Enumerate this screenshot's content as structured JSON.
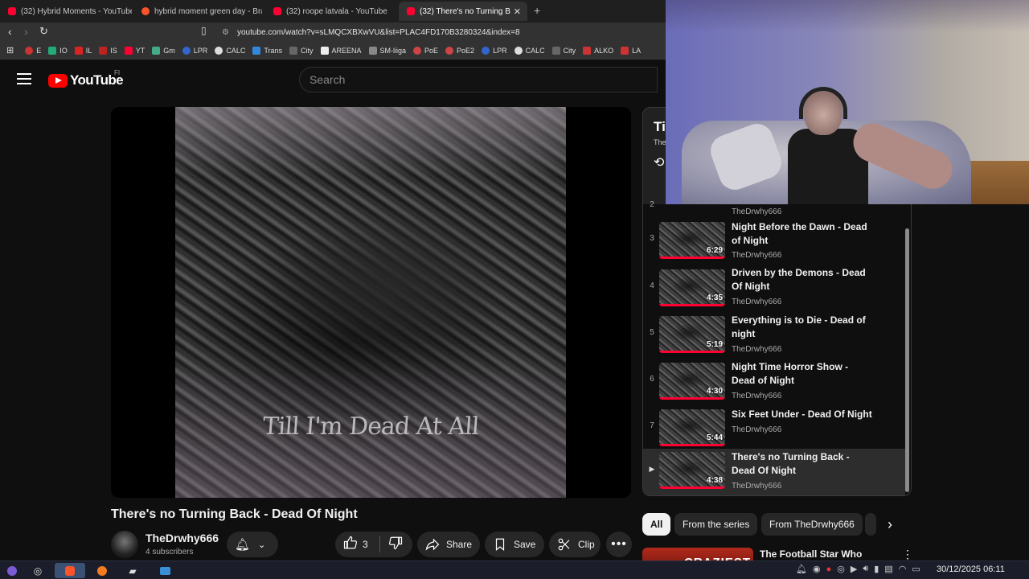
{
  "browser": {
    "tabs": [
      {
        "label": "(32) Hybrid Moments - YouTube",
        "favicon": "youtube-icon"
      },
      {
        "label": "hybrid moment green day - Bra",
        "favicon": "brave-icon"
      },
      {
        "label": "(32) roope latvala - YouTube",
        "favicon": "youtube-icon"
      },
      {
        "label": "(32) There's no Turning B",
        "favicon": "youtube-icon",
        "active": true
      }
    ],
    "url": "youtube.com/watch?v=sLMQCXBXwVU&list=PLAC4FD170B3280324&index=8",
    "bookmarks": [
      "E",
      "IO",
      "IL",
      "IS",
      "YT",
      "Gm",
      "LPR",
      "CALC",
      "Trans",
      "City",
      "AREENA",
      "SM-liiga",
      "PoE",
      "PoE2",
      "LPR",
      "CALC",
      "City",
      "ALKO",
      "LA"
    ]
  },
  "masthead": {
    "logo_text": "YouTube",
    "country_code": "FI",
    "search_placeholder": "Search"
  },
  "video": {
    "title": "There's no Turning Back - Dead Of Night",
    "thumbnail_text": "Till I'm Dead At All",
    "channel_name": "TheDrwhy666",
    "subscribers": "4 subscribers",
    "likes": "3",
    "share_label": "Share",
    "save_label": "Save",
    "clip_label": "Clip"
  },
  "playlist": {
    "title": "Ti",
    "subtitle": "The",
    "items": [
      {
        "index": "2",
        "title": "",
        "channel": "TheDrwhy666",
        "duration": ""
      },
      {
        "index": "3",
        "title": "Night Before the Dawn - Dead of Night",
        "channel": "TheDrwhy666",
        "duration": "6:29"
      },
      {
        "index": "4",
        "title": "Driven by the Demons - Dead Of Night",
        "channel": "TheDrwhy666",
        "duration": "4:35"
      },
      {
        "index": "5",
        "title": "Everything is to Die - Dead of night",
        "channel": "TheDrwhy666",
        "duration": "5:19"
      },
      {
        "index": "6",
        "title": "Night Time Horror Show - Dead of Night",
        "channel": "TheDrwhy666",
        "duration": "4:30"
      },
      {
        "index": "7",
        "title": "Six Feet Under - Dead Of Night",
        "channel": "TheDrwhy666",
        "duration": "5:44"
      },
      {
        "index": "▶",
        "title": "There's no Turning Back - Dead Of Night",
        "channel": "TheDrwhy666",
        "duration": "4:38",
        "current": true
      }
    ]
  },
  "chips": [
    "All",
    "From the series",
    "From TheDrwhy666"
  ],
  "recommendation": {
    "thumb_text": "CRAZIEST",
    "title": "The Football Star Who"
  },
  "taskbar": {
    "clock": "30/12/2025 06:11"
  },
  "colors": {
    "accent": "#ff0033",
    "background": "#0f0f0f",
    "surface": "#272727"
  }
}
